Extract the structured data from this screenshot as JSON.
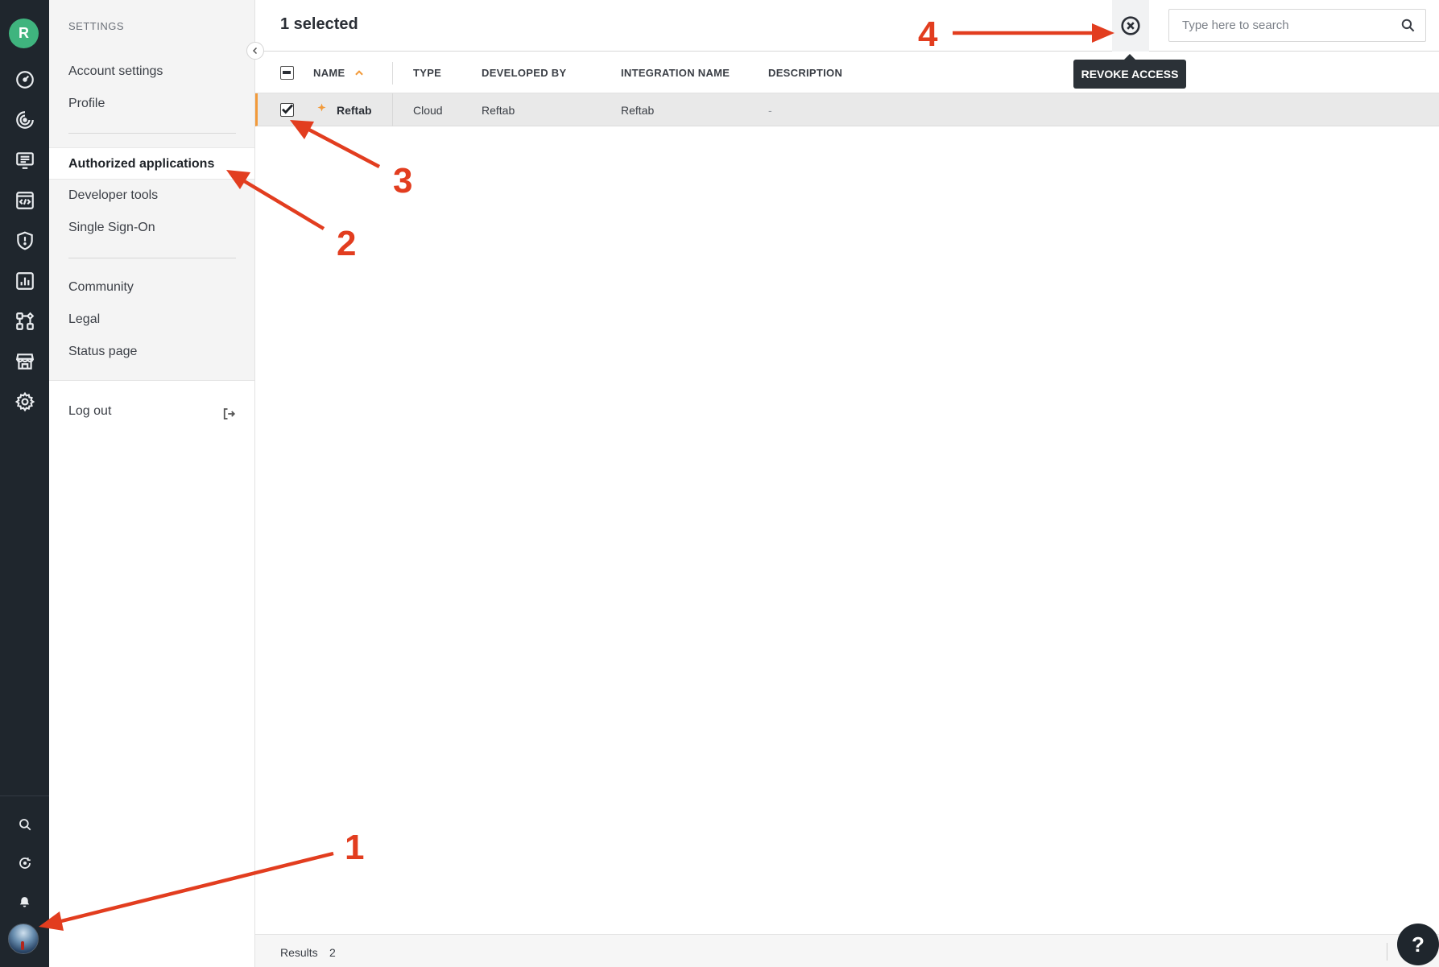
{
  "rail": {
    "org_initial": "R",
    "icons": [
      "dashboard-icon",
      "analytics-icon",
      "monitor-icon",
      "code-icon",
      "shield-icon",
      "reports-icon",
      "workflow-icon",
      "store-icon",
      "gear-icon"
    ],
    "bottom_icons": [
      "search-icon",
      "refresh-icon",
      "bell-icon"
    ]
  },
  "sidebar": {
    "title": "SETTINGS",
    "group1": [
      "Account settings",
      "Profile"
    ],
    "group2": [
      "Authorized applications",
      "Developer tools",
      "Single Sign-On"
    ],
    "group3": [
      "Community",
      "Legal",
      "Status page"
    ],
    "logout": "Log out",
    "active": "Authorized applications"
  },
  "topbar": {
    "selected_text": "1 selected",
    "tooltip": "REVOKE ACCESS",
    "search_placeholder": "Type here to search"
  },
  "table": {
    "columns": [
      "NAME",
      "TYPE",
      "DEVELOPED BY",
      "INTEGRATION NAME",
      "DESCRIPTION"
    ],
    "sort_column": "NAME",
    "sort_dir": "asc",
    "rows": [
      {
        "name": "Reftab",
        "type": "Cloud",
        "developed_by": "Reftab",
        "integration_name": "Reftab",
        "description": "-",
        "selected": true
      }
    ]
  },
  "footer": {
    "results_label": "Results",
    "results_count": "2"
  },
  "help_label": "?",
  "annotations": [
    "1",
    "2",
    "3",
    "4"
  ],
  "colors": {
    "rail_bg": "#1f262d",
    "accent_orange": "#f29a3a",
    "annotation_red": "#e23d1f",
    "org_avatar": "#3fb47e"
  }
}
